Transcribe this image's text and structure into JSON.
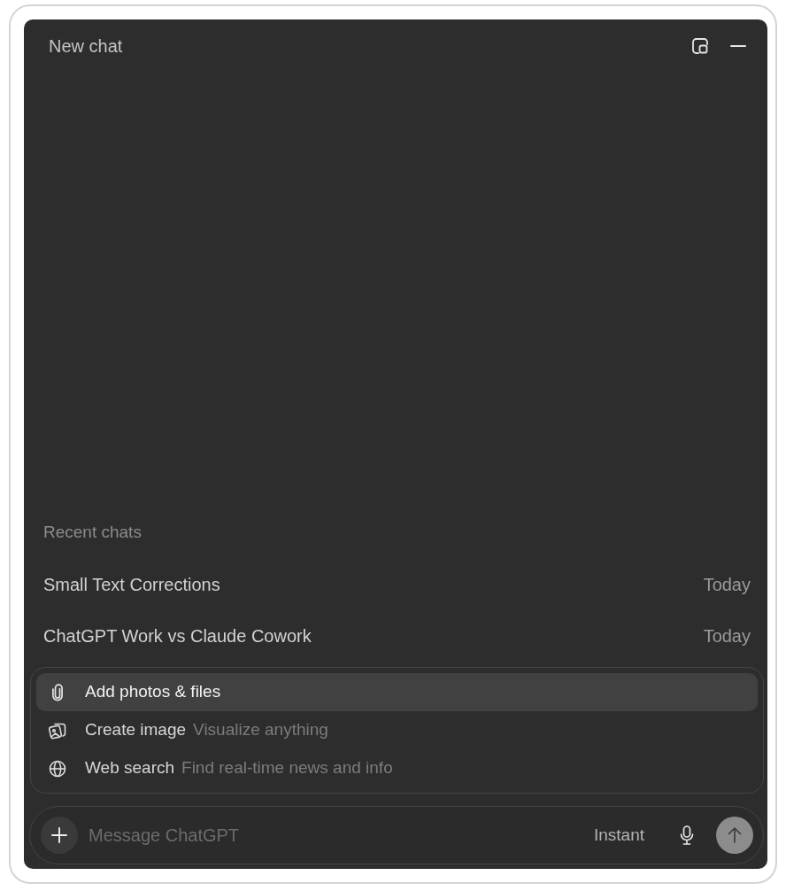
{
  "window": {
    "title": "New chat"
  },
  "recent_chats": {
    "heading": "Recent chats",
    "items": [
      {
        "title": "Small Text Corrections",
        "date": "Today"
      },
      {
        "title": "ChatGPT Work vs Claude Cowork",
        "date": "Today"
      }
    ]
  },
  "attach_menu": {
    "items": [
      {
        "kind": "files",
        "label": "Add photos & files",
        "selected": true
      },
      {
        "kind": "image",
        "label": "Create image",
        "description": "Visualize anything",
        "selected": false
      },
      {
        "kind": "search",
        "label": "Web search",
        "description": "Find real-time news and info",
        "selected": false
      }
    ]
  },
  "composer": {
    "placeholder": "Message ChatGPT",
    "model": "Instant"
  }
}
